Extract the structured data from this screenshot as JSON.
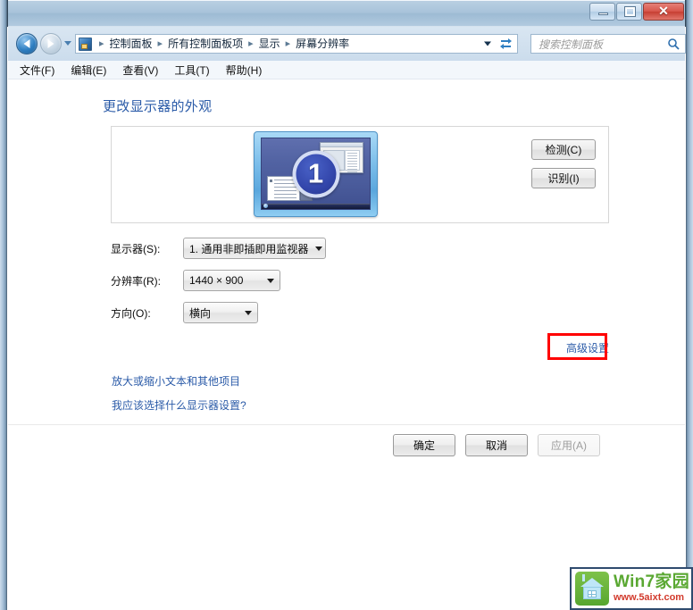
{
  "window": {
    "minimize_label": "Minimize",
    "maximize_label": "Maximize",
    "close_label": "✕"
  },
  "addressbar": {
    "back_tooltip": "后退",
    "forward_tooltip": "前进",
    "breadcrumbs": [
      "控制面板",
      "所有控制面板项",
      "显示",
      "屏幕分辨率"
    ],
    "separator": "▸",
    "refresh_tooltip": "刷新"
  },
  "search": {
    "placeholder": "搜索控制面板",
    "value": ""
  },
  "menubar": {
    "items": [
      {
        "label": "文件(F)"
      },
      {
        "label": "编辑(E)"
      },
      {
        "label": "查看(V)"
      },
      {
        "label": "工具(T)"
      },
      {
        "label": "帮助(H)"
      }
    ]
  },
  "main": {
    "page_title": "更改显示器的外观",
    "preview": {
      "monitor_number": "1"
    },
    "side_buttons": [
      {
        "label": "检测(C)"
      },
      {
        "label": "识别(I)"
      }
    ],
    "fields": [
      {
        "label": "显示器(S):",
        "value": "1. 通用非即插即用监视器"
      },
      {
        "label": "分辨率(R):",
        "value": "1440 × 900"
      },
      {
        "label": "方向(O):",
        "value": "横向"
      }
    ],
    "advanced_link": "高级设置",
    "links": [
      {
        "label": "放大或缩小文本和其他项目"
      },
      {
        "label": "我应该选择什么显示器设置?"
      }
    ],
    "dialog_buttons": [
      {
        "label": "确定",
        "disabled": false
      },
      {
        "label": "取消",
        "disabled": false
      },
      {
        "label": "应用(A)",
        "disabled": true
      }
    ]
  },
  "watermark": {
    "title": "Win7家园",
    "url": "www.5aixt.com"
  },
  "colors": {
    "link": "#2b5ba8",
    "highlight": "#ff0000",
    "watermark_title": "#5aa832",
    "watermark_url": "#d23a2c"
  }
}
